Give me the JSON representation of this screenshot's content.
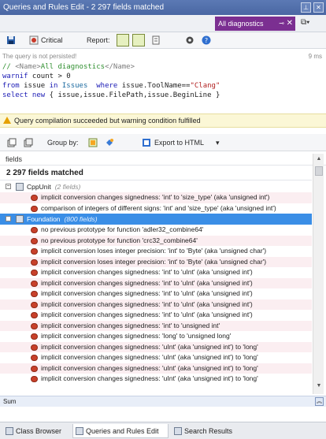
{
  "window": {
    "title": "Queries and Rules Edit - 2 297 fields matched"
  },
  "doc_tab": {
    "label": "All diagnostics"
  },
  "toolbar": {
    "severity_label": "Critical",
    "report_label": "Report:"
  },
  "status": {
    "message": "The query is not persisted!",
    "timing": "9 ms"
  },
  "code": {
    "line1_comment": "// ",
    "line1_open": "<Name>",
    "line1_text": "All diagnostics",
    "line1_close": "</Name>",
    "line2_kw": "warnif",
    "line2_rest": " count > 0",
    "line3_from": "from",
    "line3_issue": " issue ",
    "line3_in": "in",
    "line3_issues": " Issues",
    "line3_where": "  where",
    "line3_cond": " issue.ToolName==",
    "line3_str": "\"Clang\"",
    "line4_select": "select",
    "line4_new": " new",
    "line4_rest": " { issue,issue.FilePath,issue.BeginLine }"
  },
  "warning": {
    "message": "Query compilation succeeded but warning condition fulfilled"
  },
  "results_toolbar": {
    "group_by_label": "Group by:",
    "export_label": "Export to HTML"
  },
  "table": {
    "column_header": "fields",
    "match_count": "2 297 fields matched",
    "groups": [
      {
        "name": "CppUnit",
        "count": "(2 fields)",
        "items": [
          "implicit conversion changes signedness: 'int' to 'size_type' (aka 'unsigned int')",
          "comparison of integers of different signs: 'int' and 'size_type' (aka 'unsigned int')"
        ]
      },
      {
        "name": "Foundation",
        "count": "(800 fields)",
        "items": [
          "no previous prototype for function 'adler32_combine64'",
          "no previous prototype for function 'crc32_combine64'",
          "implicit conversion loses integer precision: 'int' to 'Byte' (aka 'unsigned char')",
          "implicit conversion loses integer precision: 'int' to 'Byte' (aka 'unsigned char')",
          "implicit conversion changes signedness: 'int' to 'uInt' (aka 'unsigned int')",
          "implicit conversion changes signedness: 'int' to 'uInt' (aka 'unsigned int')",
          "implicit conversion changes signedness: 'int' to 'uInt' (aka 'unsigned int')",
          "implicit conversion changes signedness: 'int' to 'uInt' (aka 'unsigned int')",
          "implicit conversion changes signedness: 'int' to 'uInt' (aka 'unsigned int')",
          "implicit conversion changes signedness: 'int' to 'unsigned int'",
          "implicit conversion changes signedness: 'long' to 'unsigned long'",
          "implicit conversion changes signedness: 'uInt' (aka 'unsigned int') to 'long'",
          "implicit conversion changes signedness: 'uInt' (aka 'unsigned int') to 'long'",
          "implicit conversion changes signedness: 'uInt' (aka 'unsigned int') to 'long'",
          "implicit conversion changes signedness: 'uInt' (aka 'unsigned int') to 'long'"
        ]
      }
    ]
  },
  "sum_bar": {
    "label": "Sum"
  },
  "bottom_tabs": [
    {
      "label": "Class Browser"
    },
    {
      "label": "Queries and Rules Edit"
    },
    {
      "label": "Search Results"
    }
  ],
  "colors": {
    "accent_tab": "#7b2f91",
    "selection": "#3a8ee6",
    "warning_bg": "#fbf7d6"
  }
}
